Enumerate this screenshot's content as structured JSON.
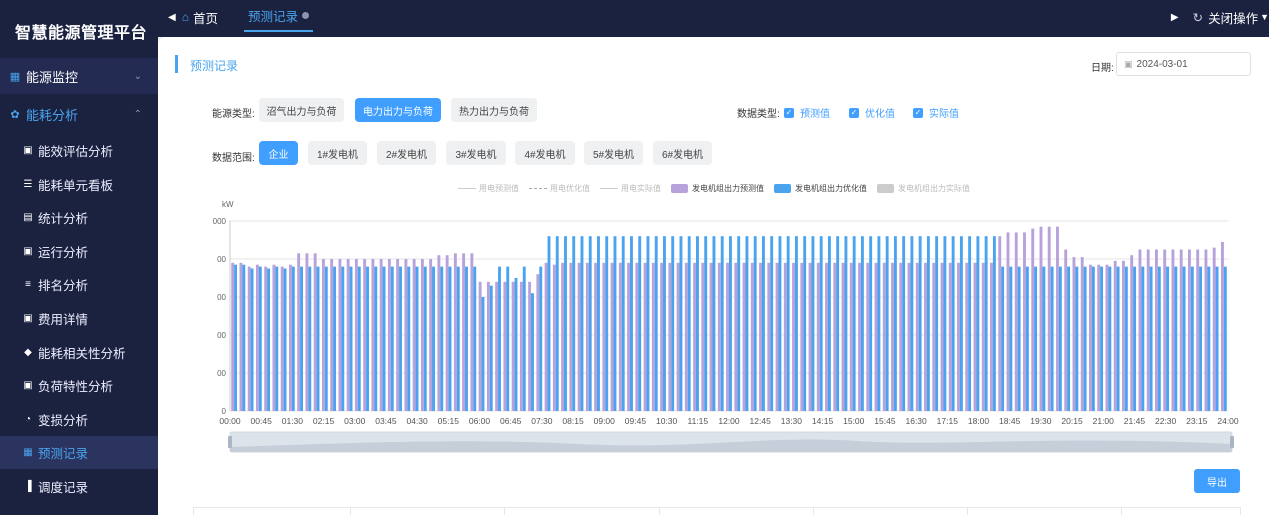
{
  "app": {
    "title": "智慧能源管理平台"
  },
  "sidebar": {
    "group_monitor": {
      "label": "能源监控",
      "icon": "grid-icon"
    },
    "group_analysis": {
      "label": "能耗分析",
      "icon": "gear-icon"
    },
    "items": [
      {
        "label": "能效评估分析",
        "icon": "save-icon"
      },
      {
        "label": "能耗单元看板",
        "icon": "stack-icon"
      },
      {
        "label": "统计分析",
        "icon": "clipboard-icon"
      },
      {
        "label": "运行分析",
        "icon": "save-icon"
      },
      {
        "label": "排名分析",
        "icon": "list-icon"
      },
      {
        "label": "费用详情",
        "icon": "save-icon"
      },
      {
        "label": "能耗相关性分析",
        "icon": "shield-icon"
      },
      {
        "label": "负荷特性分析",
        "icon": "save-icon"
      },
      {
        "label": "变损分析",
        "icon": "pie-icon"
      },
      {
        "label": "预测记录",
        "icon": "doc-icon",
        "active": true
      },
      {
        "label": "调度记录",
        "icon": "bar-chart-icon"
      }
    ]
  },
  "topbar": {
    "home_tab": "首页",
    "active_tab": "预测记录",
    "close_ops": "关闭操作"
  },
  "page": {
    "title": "预测记录",
    "date_label": "日期:",
    "date_value": "2024-03-01",
    "energy_type_label": "能源类型:",
    "energy_types": [
      "沼气出力与负荷",
      "电力出力与负荷",
      "热力出力与负荷"
    ],
    "energy_type_selected": "电力出力与负荷",
    "data_type_label": "数据类型:",
    "data_types": [
      "预测值",
      "优化值",
      "实际值"
    ],
    "scope_label": "数据范围:",
    "scopes": [
      "企业",
      "1#发电机",
      "2#发电机",
      "3#发电机",
      "4#发电机",
      "5#发电机",
      "6#发电机"
    ],
    "scope_selected": "企业",
    "export_label": "导出"
  },
  "colors": {
    "accent": "#409eff",
    "sidebar_bg": "#1b2240",
    "predicted": "#b7a2dc",
    "optimized": "#4aa3ee",
    "actual": "#cccccc"
  },
  "chart_data": {
    "type": "bar",
    "ylabel": "kW",
    "y_tick_labels": [
      "0",
      "00",
      "00",
      "00",
      "00",
      "000"
    ],
    "legend": [
      "用电预测值",
      "用电优化值",
      "用电实际值",
      "发电机组出力预测值",
      "发电机组出力优化值",
      "发电机组出力实际值"
    ],
    "x_tick_labels": [
      "00:00",
      "00:45",
      "01:30",
      "02:15",
      "03:00",
      "03:45",
      "04:30",
      "05:15",
      "06:00",
      "06:45",
      "07:30",
      "08:15",
      "09:00",
      "09:45",
      "10:30",
      "11:15",
      "12:00",
      "12:45",
      "13:30",
      "14:15",
      "15:00",
      "15:45",
      "16:30",
      "17:15",
      "18:00",
      "18:45",
      "19:30",
      "20:15",
      "21:00",
      "21:45",
      "22:30",
      "23:15",
      "24:00"
    ],
    "y_fraction_max": 1.0,
    "series": [
      {
        "name": "发电机组出力预测值",
        "values": [
          0.78,
          0.78,
          0.76,
          0.77,
          0.76,
          0.77,
          0.76,
          0.77,
          0.83,
          0.83,
          0.83,
          0.8,
          0.8,
          0.8,
          0.8,
          0.8,
          0.8,
          0.8,
          0.8,
          0.8,
          0.8,
          0.8,
          0.8,
          0.8,
          0.8,
          0.82,
          0.82,
          0.83,
          0.83,
          0.83,
          0.68,
          0.68,
          0.68,
          0.68,
          0.68,
          0.68,
          0.68,
          0.72,
          0.78,
          0.77,
          0.78,
          0.78,
          0.78,
          0.78,
          0.78,
          0.78,
          0.78,
          0.78,
          0.78,
          0.78,
          0.78,
          0.78,
          0.78,
          0.78,
          0.78,
          0.78,
          0.78,
          0.78,
          0.78,
          0.78,
          0.78,
          0.78,
          0.78,
          0.78,
          0.78,
          0.78,
          0.78,
          0.78,
          0.78,
          0.78,
          0.78,
          0.78,
          0.78,
          0.78,
          0.78,
          0.78,
          0.78,
          0.78,
          0.78,
          0.78,
          0.78,
          0.78,
          0.78,
          0.78,
          0.78,
          0.78,
          0.78,
          0.78,
          0.78,
          0.78,
          0.78,
          0.78,
          0.78,
          0.92,
          0.94,
          0.94,
          0.94,
          0.96,
          0.97,
          0.97,
          0.97,
          0.85,
          0.81,
          0.81,
          0.77,
          0.77,
          0.77,
          0.79,
          0.79,
          0.82,
          0.85,
          0.85,
          0.85,
          0.85,
          0.85,
          0.85,
          0.85,
          0.85,
          0.85,
          0.86,
          0.89
        ]
      },
      {
        "name": "发电机组出力优化值",
        "values": [
          0.77,
          0.77,
          0.75,
          0.76,
          0.75,
          0.76,
          0.75,
          0.76,
          0.76,
          0.76,
          0.76,
          0.76,
          0.76,
          0.76,
          0.76,
          0.76,
          0.76,
          0.76,
          0.76,
          0.76,
          0.76,
          0.76,
          0.76,
          0.76,
          0.76,
          0.76,
          0.76,
          0.76,
          0.76,
          0.76,
          0.6,
          0.66,
          0.76,
          0.76,
          0.7,
          0.76,
          0.62,
          0.76,
          0.92,
          0.92,
          0.92,
          0.92,
          0.92,
          0.92,
          0.92,
          0.92,
          0.92,
          0.92,
          0.92,
          0.92,
          0.92,
          0.92,
          0.92,
          0.92,
          0.92,
          0.92,
          0.92,
          0.92,
          0.92,
          0.92,
          0.92,
          0.92,
          0.92,
          0.92,
          0.92,
          0.92,
          0.92,
          0.92,
          0.92,
          0.92,
          0.92,
          0.92,
          0.92,
          0.92,
          0.92,
          0.92,
          0.92,
          0.92,
          0.92,
          0.92,
          0.92,
          0.92,
          0.92,
          0.92,
          0.92,
          0.92,
          0.92,
          0.92,
          0.92,
          0.92,
          0.92,
          0.92,
          0.92,
          0.76,
          0.76,
          0.76,
          0.76,
          0.76,
          0.76,
          0.76,
          0.76,
          0.76,
          0.76,
          0.76,
          0.76,
          0.76,
          0.76,
          0.76,
          0.76,
          0.76,
          0.76,
          0.76,
          0.76,
          0.76,
          0.76,
          0.76,
          0.76,
          0.76,
          0.76,
          0.76,
          0.76
        ]
      }
    ]
  }
}
